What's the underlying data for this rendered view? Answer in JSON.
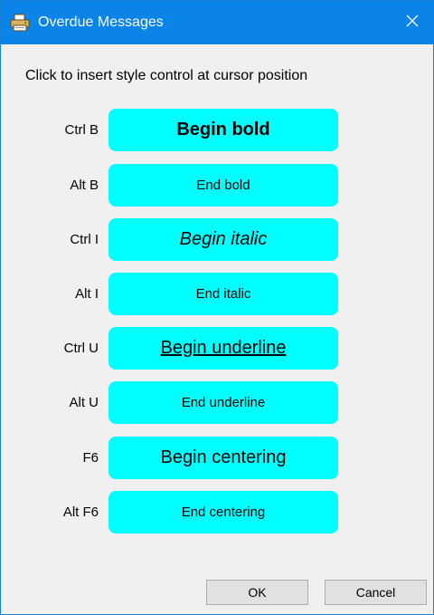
{
  "window": {
    "title": "Overdue Messages",
    "icon": "printer-icon",
    "close_glyph": "✕"
  },
  "instruction": "Click to insert style control at cursor position",
  "style_controls": [
    {
      "shortcut": "Ctrl B",
      "label": "Begin bold"
    },
    {
      "shortcut": "Alt B",
      "label": "End bold"
    },
    {
      "shortcut": "Ctrl I",
      "label": "Begin italic"
    },
    {
      "shortcut": "Alt I",
      "label": "End italic"
    },
    {
      "shortcut": "Ctrl U",
      "label": "Begin underline"
    },
    {
      "shortcut": "Alt U",
      "label": "End underline"
    },
    {
      "shortcut": "F6",
      "label": "Begin centering"
    },
    {
      "shortcut": "Alt F6",
      "label": "End centering"
    }
  ],
  "buttons": {
    "ok_label": "OK",
    "cancel_label": "Cancel"
  },
  "colors": {
    "titlebar": "#0a84e6",
    "style_button": "#00ffff",
    "dialog_background": "#f0f0f0"
  }
}
